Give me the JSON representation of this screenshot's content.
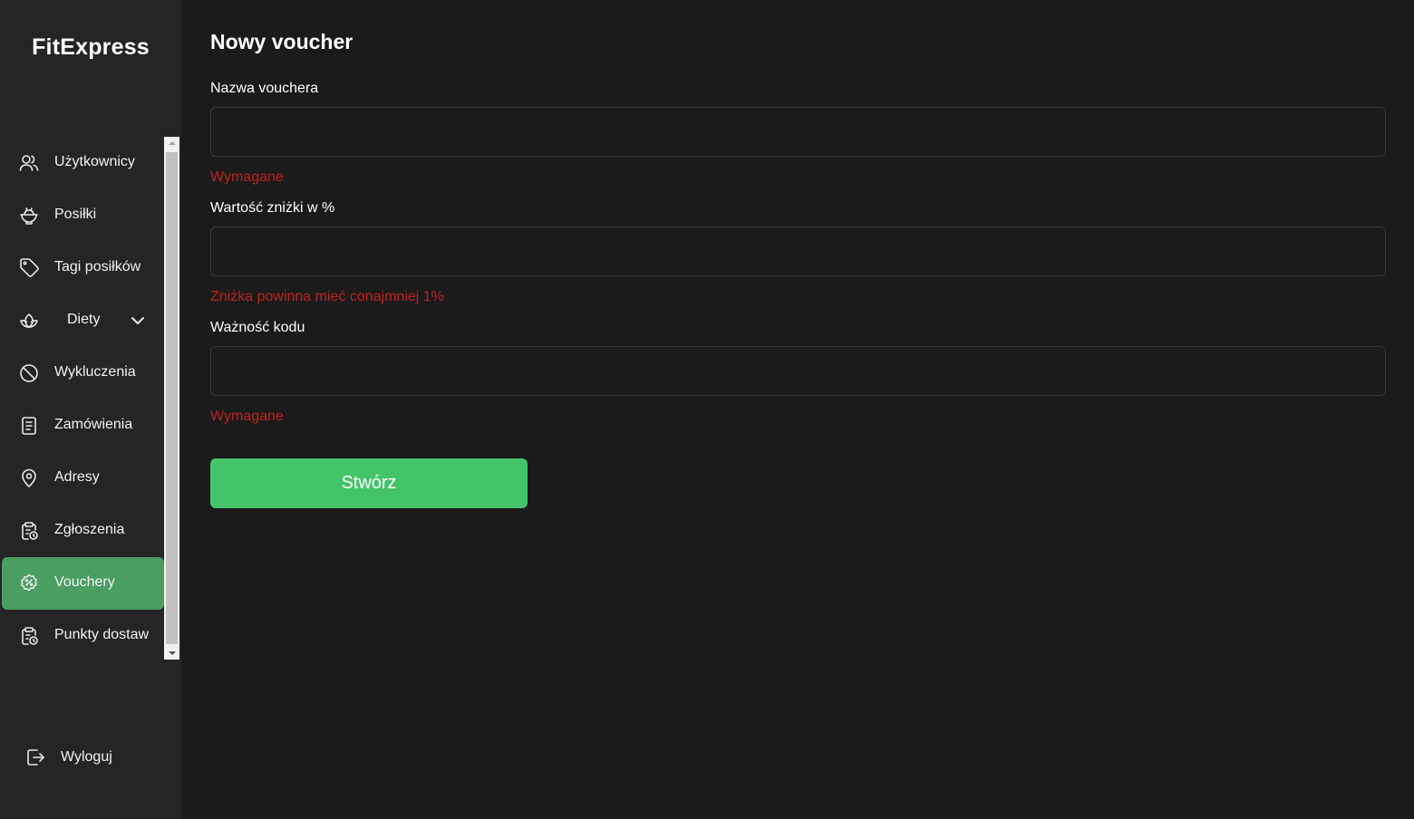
{
  "app": {
    "brand": "FitExpress"
  },
  "sidebar": {
    "items": [
      {
        "label": "Użytkownicy",
        "icon": "users-icon"
      },
      {
        "label": "Posiłki",
        "icon": "food-bowl-icon"
      },
      {
        "label": "Tagi posiłków",
        "icon": "tag-icon"
      },
      {
        "label": "Diety",
        "icon": "lotus-icon",
        "has_dropdown": true
      },
      {
        "label": "Wykluczenia",
        "icon": "ban-icon"
      },
      {
        "label": "Zamówienia",
        "icon": "document-icon"
      },
      {
        "label": "Adresy",
        "icon": "location-pin-icon"
      },
      {
        "label": "Zgłoszenia",
        "icon": "clipboard-clock-icon"
      },
      {
        "label": "Vouchery",
        "icon": "discount-badge-icon",
        "active": true
      },
      {
        "label": "Punkty dostaw",
        "icon": "clipboard-clock-icon"
      }
    ],
    "logout_label": "Wyloguj",
    "active_color": "#4a9e61"
  },
  "form": {
    "title": "Nowy voucher",
    "fields": [
      {
        "label": "Nazwa vouchera",
        "value": "",
        "error": "Wymagane"
      },
      {
        "label": "Wartość zniżki w %",
        "value": "",
        "error": "Zniżka powinna mieć conajmniej 1%"
      },
      {
        "label": "Ważność kodu",
        "value": "",
        "error": "Wymagane"
      }
    ],
    "submit_label": "Stwórz",
    "submit_color": "#44c46a",
    "error_color": "#c0211f"
  }
}
